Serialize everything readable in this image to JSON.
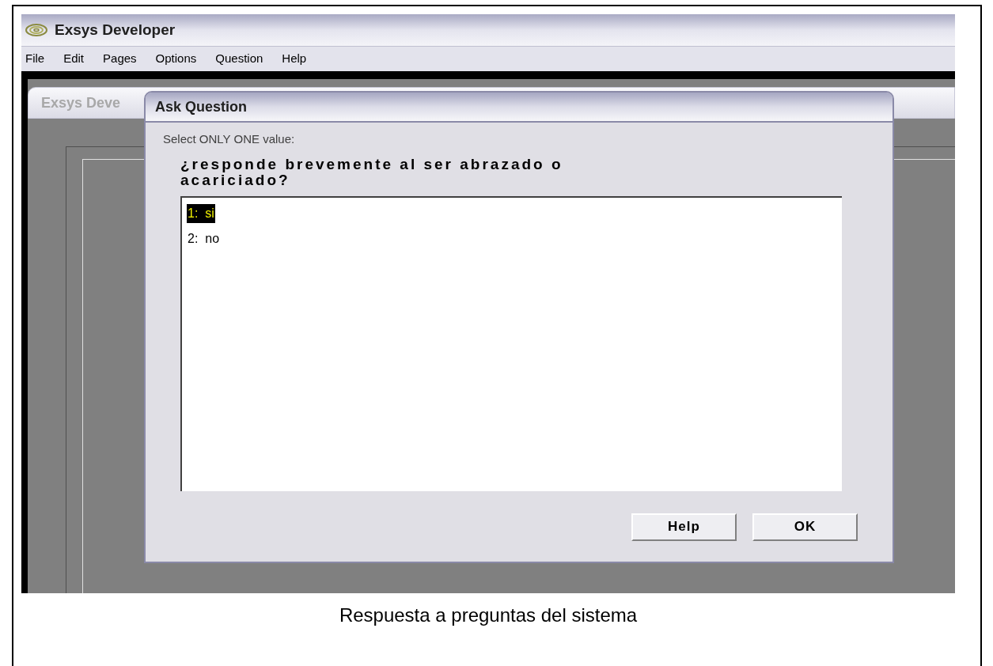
{
  "app": {
    "title": "Exsys Developer",
    "menu": [
      "File",
      "Edit",
      "Pages",
      "Options",
      "Question",
      "Help"
    ]
  },
  "background_window": {
    "title": "Exsys Deve"
  },
  "dialog": {
    "title": "Ask Question",
    "instruction": "Select ONLY ONE value:",
    "question": "¿responde brevemente al ser abrazado o acariciado?",
    "options": [
      {
        "label": "1:  si",
        "selected": true
      },
      {
        "label": "2:  no",
        "selected": false
      }
    ],
    "buttons": [
      "Help",
      "OK"
    ]
  },
  "caption": "Respuesta a preguntas del sistema"
}
